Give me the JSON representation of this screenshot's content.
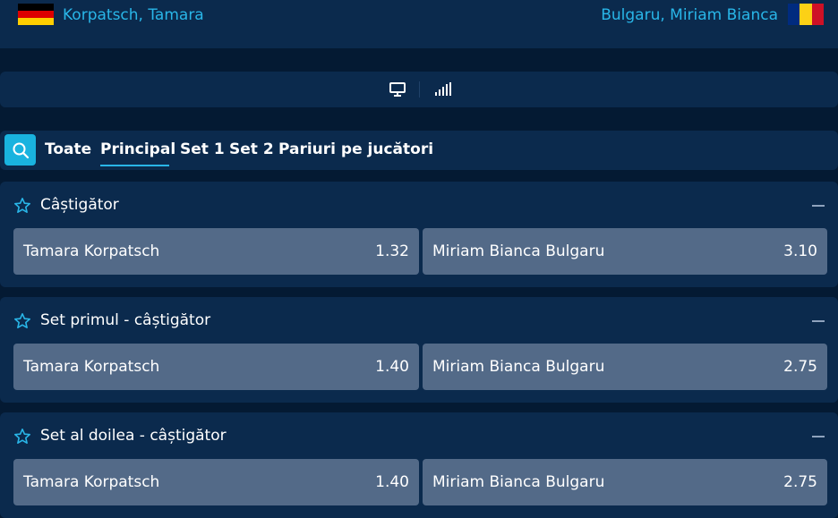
{
  "colors": {
    "background": "#041a33",
    "panel": "#0b2a4d",
    "accent": "#29b6e8",
    "odd_button": "#536a88"
  },
  "match": {
    "home": {
      "name": "Korpatsch, Tamara",
      "flag_icon": "germany-flag-icon"
    },
    "away": {
      "name": "Bulgaru, Miriam Bianca",
      "flag_icon": "romania-flag-icon"
    }
  },
  "view_bar": {
    "icons": [
      "monitor-icon",
      "stats-bars-icon"
    ]
  },
  "tabs": [
    {
      "label": "Toate",
      "active": false
    },
    {
      "label": "Principal",
      "active": true
    },
    {
      "label": "Set 1",
      "active": false
    },
    {
      "label": "Set 2",
      "active": false
    },
    {
      "label": "Pariuri pe jucători",
      "active": false
    }
  ],
  "markets": [
    {
      "title": "Câștigător",
      "selections": [
        {
          "name": "Tamara Korpatsch",
          "odd": "1.32"
        },
        {
          "name": "Miriam Bianca Bulgaru",
          "odd": "3.10"
        }
      ]
    },
    {
      "title": "Set primul - câștigător",
      "selections": [
        {
          "name": "Tamara Korpatsch",
          "odd": "1.40"
        },
        {
          "name": "Miriam Bianca Bulgaru",
          "odd": "2.75"
        }
      ]
    },
    {
      "title": "Set al doilea - câștigător",
      "selections": [
        {
          "name": "Tamara Korpatsch",
          "odd": "1.40"
        },
        {
          "name": "Miriam Bianca Bulgaru",
          "odd": "2.75"
        }
      ]
    }
  ]
}
